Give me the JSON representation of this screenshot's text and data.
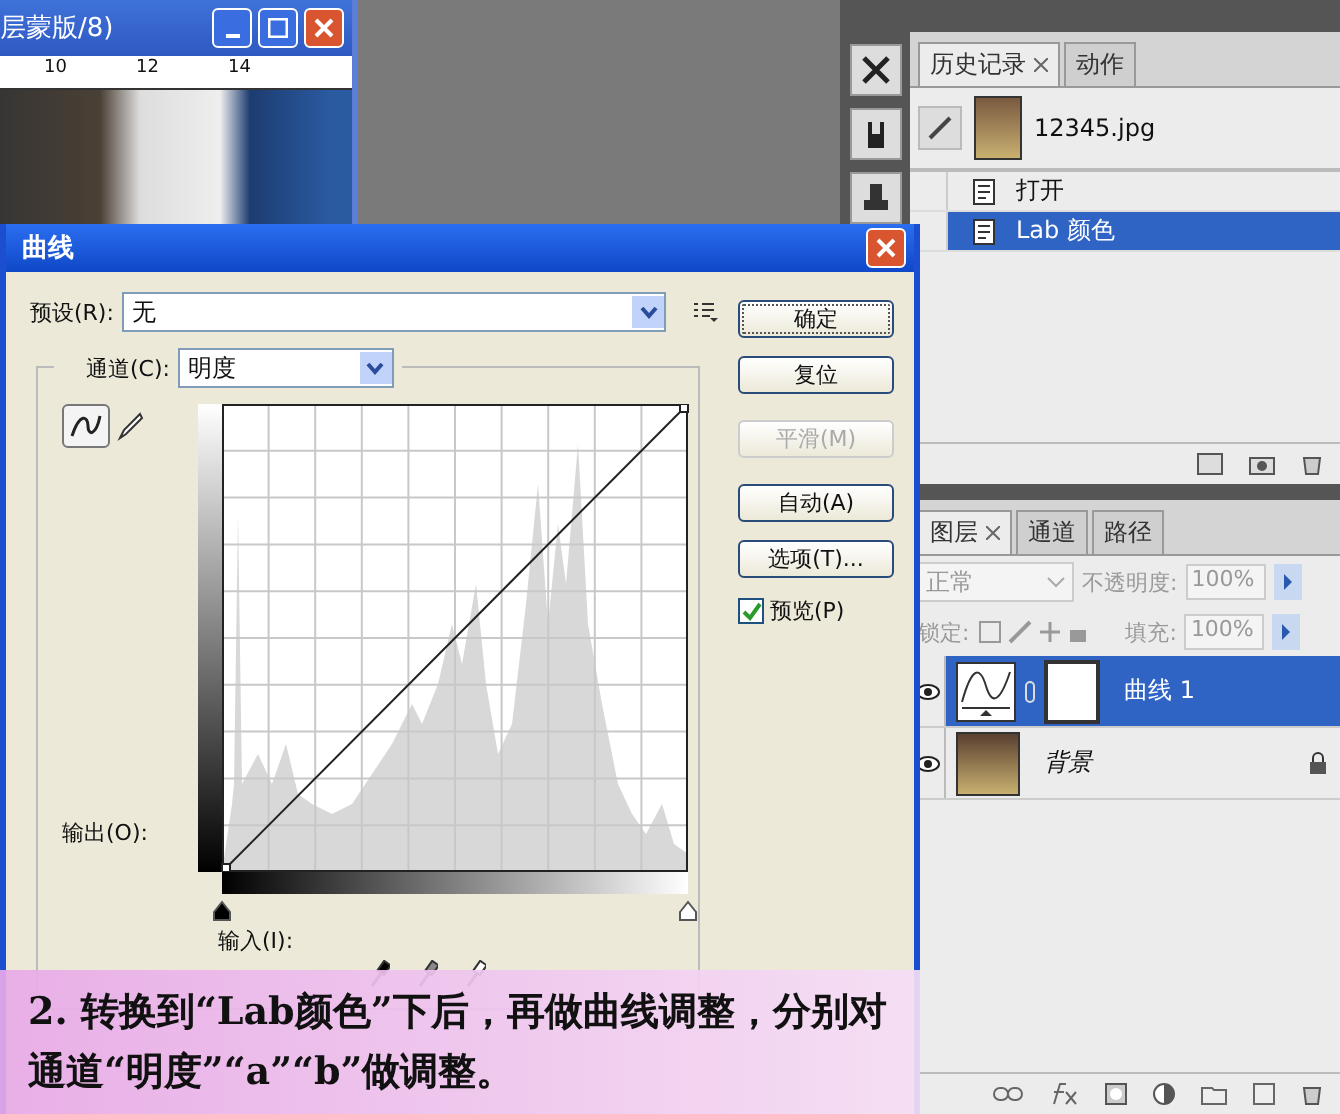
{
  "image_window": {
    "title": "层蒙版/8)",
    "ruler_labels": [
      "10",
      "12",
      "14"
    ]
  },
  "curves_dialog": {
    "title": "曲线",
    "preset": {
      "label": "预设(R):",
      "value": "无"
    },
    "channel": {
      "label": "通道(C):",
      "value": "明度"
    },
    "output_label": "输出(O):",
    "input_label": "输入(I):",
    "buttons": [
      {
        "label": "确定",
        "disabled": false,
        "default": true
      },
      {
        "label": "复位",
        "disabled": false,
        "default": false
      },
      {
        "label": "平滑(M)",
        "disabled": true,
        "default": false
      },
      {
        "label": "自动(A)",
        "disabled": false,
        "default": false
      },
      {
        "label": "选项(T)...",
        "disabled": false,
        "default": false
      }
    ],
    "preview": {
      "label": "预览(P)",
      "checked": true
    },
    "input_sliders": [
      {
        "level": 0
      },
      {
        "level": 1
      }
    ]
  },
  "history_panel": {
    "tabs": [
      {
        "label": "历史记录",
        "selected": true
      },
      {
        "label": "动作",
        "selected": false
      }
    ],
    "snapshot": "12345.jpg",
    "items": [
      {
        "label": "打开",
        "selected": false
      },
      {
        "label": "Lab 颜色",
        "selected": true
      }
    ]
  },
  "layers_panel": {
    "tabs": [
      {
        "label": "图层",
        "selected": true
      },
      {
        "label": "通道",
        "selected": false
      },
      {
        "label": "路径",
        "selected": false
      }
    ],
    "blend_mode": "正常",
    "opacity_label": "不透明度:",
    "opacity": "100%",
    "lock_label": "锁定:",
    "fill_label": "填充:",
    "fill": "100%",
    "layers": [
      {
        "name": "曲线 1",
        "kind": "adjustment",
        "selected": true,
        "visible": true,
        "locked": false
      },
      {
        "name": "背景",
        "kind": "image",
        "selected": false,
        "visible": true,
        "locked": true
      }
    ]
  },
  "caption": "2. 转换到“Lab颜色”下后，再做曲线调整，分别对通道“明度”“a”“b”做调整。"
}
